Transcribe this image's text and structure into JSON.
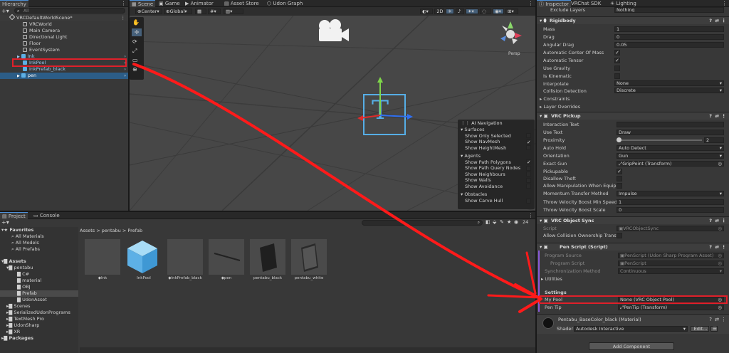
{
  "hierarchy": {
    "tab": "Hierarchy",
    "search_placeholder": "All",
    "scene": "VRCDefaultWorldScene*",
    "items": [
      "VRCWorld",
      "Main Camera",
      "Directional Light",
      "Floor",
      "EventSystem",
      "Ink",
      "InkPool",
      "InkPrefab_black",
      "pen"
    ]
  },
  "scene_view": {
    "tabs": [
      "Scene",
      "Game",
      "Animator",
      "Asset Store",
      "Udon Graph"
    ],
    "pivot": "Center",
    "space": "Global",
    "mode2d": "2D",
    "persp": "Persp",
    "nav_overlay": {
      "title": "AI Navigation",
      "surfaces": "Surfaces",
      "items": [
        {
          "label": "Show Only Selected",
          "checked": false
        },
        {
          "label": "Show NavMesh",
          "checked": true
        },
        {
          "label": "Show HeightMesh",
          "checked": false
        }
      ],
      "agents": "Agents",
      "agent_items": [
        {
          "label": "Show Path Polygons",
          "checked": true
        },
        {
          "label": "Show Path Query Nodes",
          "checked": false
        },
        {
          "label": "Show Neighbours",
          "checked": false
        },
        {
          "label": "Show Walls",
          "checked": false
        },
        {
          "label": "Show Avoidance",
          "checked": false
        }
      ],
      "obstacles": "Obstacles",
      "obstacle_items": [
        {
          "label": "Show Carve Hull",
          "checked": false
        }
      ]
    }
  },
  "project": {
    "tabs": [
      "Project",
      "Console"
    ],
    "count": "24",
    "favorites": "Favorites",
    "fav_items": [
      "All Materials",
      "All Models",
      "All Prefabs"
    ],
    "assets": "Assets",
    "tree": [
      "pentabu",
      "C#",
      "material",
      "OBJ",
      "Prefab",
      "UdonAsset",
      "Scenes",
      "SerializedUdonPrograms",
      "TextMesh Pro",
      "UdonSharp",
      "XR"
    ],
    "packages": "Packages",
    "breadcrumb": [
      "Assets",
      "pentabu",
      "Prefab"
    ],
    "files": [
      "Ink",
      "InkPool",
      "InkPrefab_black",
      "pen",
      "pentabu_black",
      "pentabu_white"
    ]
  },
  "inspector": {
    "tabs": [
      "Inspector",
      "VRChat SDK",
      "Lighting"
    ],
    "exclude_layers": {
      "label": "Exclude Layers",
      "value": "Nothing"
    },
    "rigidbody": {
      "title": "Rigidbody",
      "mass": {
        "label": "Mass",
        "value": "1"
      },
      "drag": {
        "label": "Drag",
        "value": "0"
      },
      "angular_drag": {
        "label": "Angular Drag",
        "value": "0.05"
      },
      "auto_center": {
        "label": "Automatic Center Of Mass",
        "checked": true
      },
      "auto_tensor": {
        "label": "Automatic Tensor",
        "checked": true
      },
      "use_gravity": {
        "label": "Use Gravity",
        "checked": false
      },
      "is_kinematic": {
        "label": "Is Kinematic",
        "checked": false
      },
      "interpolate": {
        "label": "Interpolate",
        "value": "None"
      },
      "collision": {
        "label": "Collision Detection",
        "value": "Discrete"
      },
      "constraints": "Constraints",
      "layer_overrides": "Layer Overrides"
    },
    "pickup": {
      "title": "VRC Pickup",
      "interaction_text": {
        "label": "Interaction Text",
        "value": ""
      },
      "use_text": {
        "label": "Use Text",
        "value": "Draw"
      },
      "proximity": {
        "label": "Proximity",
        "value": "2"
      },
      "auto_hold": {
        "label": "Auto Hold",
        "value": "Auto Detect"
      },
      "orientation": {
        "label": "Orientation",
        "value": "Gun"
      },
      "exact_gun": {
        "label": "Exact Gun",
        "value": "GripPoint (Transform)"
      },
      "pickupable": {
        "label": "Pickupable",
        "checked": true
      },
      "disallow_theft": {
        "label": "Disallow Theft",
        "checked": false
      },
      "allow_manip": {
        "label": "Allow Manipulation When Equippe",
        "checked": false
      },
      "momentum": {
        "label": "Momentum Transfer Method",
        "value": "Impulse"
      },
      "throw_min": {
        "label": "Throw Velocity Boost Min Speed",
        "value": "1"
      },
      "throw_scale": {
        "label": "Throw Velocity Boost Scale",
        "value": "0"
      }
    },
    "objsync": {
      "title": "VRC Object Sync",
      "script": {
        "label": "Script",
        "value": "VRCObjectSync"
      },
      "allow_collision": {
        "label": "Allow Collision Ownership Transfe",
        "checked": false
      }
    },
    "penscript": {
      "title": "Pen Script (Script)",
      "program_source": {
        "label": "Program Source",
        "value": "PenScript (Udon Sharp Program Asset)"
      },
      "program_script": {
        "label": "Program Script",
        "value": "PenScript"
      },
      "sync_method": {
        "label": "Synchronization Method",
        "value": "Continuous"
      },
      "utilities": "Utilities",
      "settings": "Settings",
      "my_pool": {
        "label": "My Pool",
        "value": "None (VRC Object Pool)"
      },
      "pen_tip": {
        "label": "Pen Tip",
        "value": "PenTip (Transform)"
      }
    },
    "material": {
      "name": "Pentabu_BaseColor_black (Material)",
      "shader_label": "Shader",
      "shader": "Autodesk Interactive",
      "edit": "Edit..."
    },
    "add_component": "Add Component"
  },
  "colors": {
    "accent": "#4d90d8",
    "highlight_red": "#e0202a",
    "selection": "#2c5d87",
    "arrow": "#ff1a1a"
  }
}
